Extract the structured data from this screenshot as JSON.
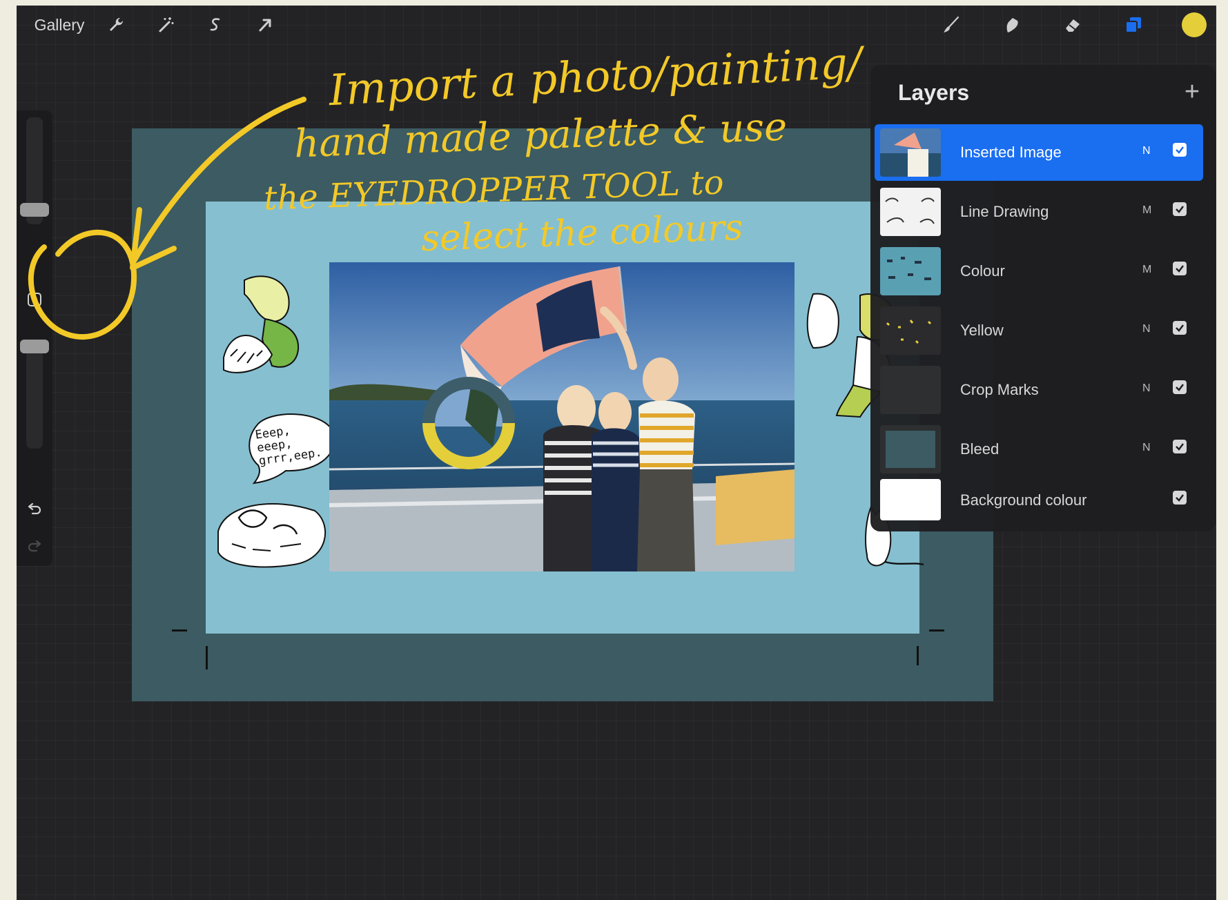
{
  "toolbar": {
    "gallery_label": "Gallery",
    "left_icons": [
      "wrench-icon",
      "magic-wand-icon",
      "selection-icon",
      "transform-arrow-icon"
    ],
    "right_icons": [
      "brush-icon",
      "smudge-icon",
      "eraser-icon",
      "layers-icon",
      "colour-swatch-icon"
    ],
    "active_colour": "#e4cf3a",
    "layers_active_color": "#1a6ef0"
  },
  "sidebar": {
    "icons": [
      "modify-square-icon",
      "undo-icon",
      "redo-icon"
    ]
  },
  "layers": {
    "title": "Layers",
    "items": [
      {
        "name": "Inserted Image",
        "mode": "N",
        "visible": true,
        "active": true
      },
      {
        "name": "Line Drawing",
        "mode": "M",
        "visible": true,
        "active": false
      },
      {
        "name": "Colour",
        "mode": "M",
        "visible": true,
        "active": false
      },
      {
        "name": "Yellow",
        "mode": "N",
        "visible": true,
        "active": false
      },
      {
        "name": "Crop Marks",
        "mode": "N",
        "visible": true,
        "active": false
      },
      {
        "name": "Bleed",
        "mode": "N",
        "visible": true,
        "active": false
      },
      {
        "name": "Background colour",
        "mode": "",
        "visible": true,
        "active": false
      }
    ]
  },
  "canvas": {
    "speech_bubble_text": "Eeep,\neeep,\ngrrr,eep.",
    "bleed_color": "#3c5b62",
    "paper_color": "#86bfd0"
  },
  "annotation": {
    "line1": "Import a photo/painting/",
    "line2": "hand made palette & use",
    "line3": "the EYEDROPPER TOOL to",
    "line4": "select the colours",
    "color": "#f3c928"
  }
}
